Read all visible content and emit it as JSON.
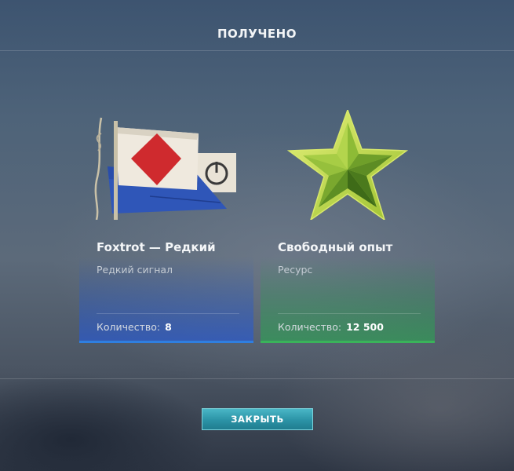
{
  "dialog": {
    "title": "ПОЛУЧЕНО",
    "close_label": "ЗАКРЫТЬ"
  },
  "rewards": [
    {
      "name": "Foxtrot — Редкий",
      "subtype": "Редкий сигнал",
      "quantity_label": "Количество:",
      "quantity_value": "8",
      "icon": "foxtrot-signal-flag-icon",
      "accent_color": "#2f7fe0"
    },
    {
      "name": "Свободный опыт",
      "subtype": "Ресурс",
      "quantity_label": "Количество:",
      "quantity_value": "12 500",
      "icon": "free-xp-star-icon",
      "accent_color": "#3ab35a"
    }
  ]
}
